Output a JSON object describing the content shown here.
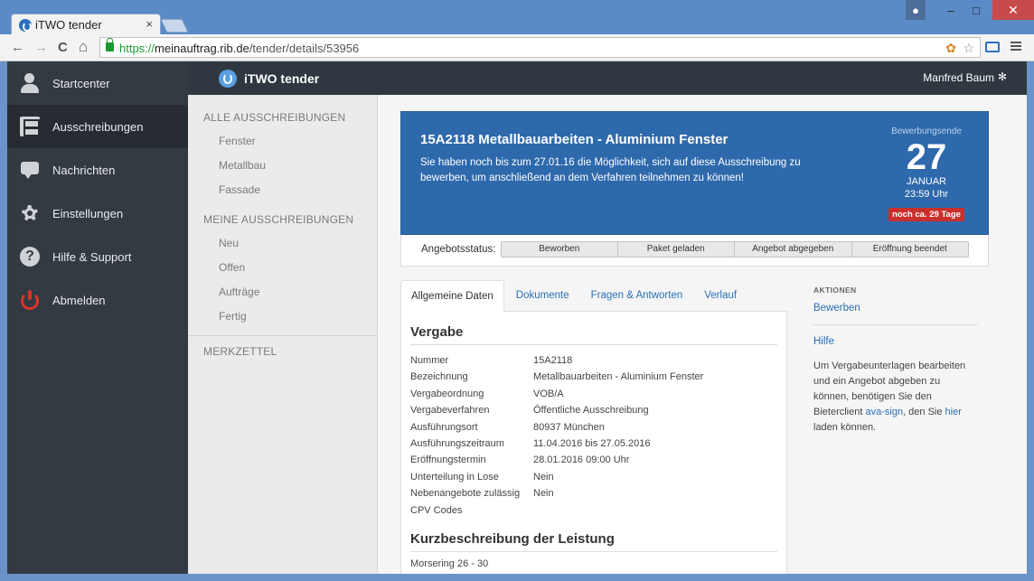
{
  "browser": {
    "tab_title": "iTWO tender",
    "tab_close": "×",
    "url_scheme": "https://",
    "url_host": "meinauftrag.rib.de",
    "url_path": "/tender/details/53956",
    "back_glyph": "←",
    "forward_glyph": "→",
    "reload_glyph": "C",
    "home_glyph": "⌂",
    "star_glyph": "☆",
    "win_min": "–",
    "win_max": "□",
    "win_close": "✕"
  },
  "app": {
    "brand": "iTWO tender",
    "user": "Manfred Baum",
    "user_gear": "✻"
  },
  "leftnav": {
    "items": [
      {
        "label": "Startcenter",
        "icon": "user-icon"
      },
      {
        "label": "Ausschreibungen",
        "icon": "cabinet-icon"
      },
      {
        "label": "Nachrichten",
        "icon": "chat-icon"
      },
      {
        "label": "Einstellungen",
        "icon": "gear-icon"
      },
      {
        "label": "Hilfe & Support",
        "icon": "help-icon"
      },
      {
        "label": "Abmelden",
        "icon": "power-icon"
      }
    ]
  },
  "subnav": {
    "all_header": "ALLE AUSSCHREIBUNGEN",
    "all_items": [
      "Fenster",
      "Metallbau",
      "Fassade"
    ],
    "mine_header": "MEINE AUSSCHREIBUNGEN",
    "mine_items": [
      "Neu",
      "Offen",
      "Aufträge",
      "Fertig"
    ],
    "watch_header": "MERKZETTEL"
  },
  "banner": {
    "title": "15A2118 Metallbauarbeiten - Aluminium Fenster",
    "text": "Sie haben noch bis zum 27.01.16 die Möglichkeit, sich auf diese Ausschreibung zu bewerben, um anschließend an dem Verfahren teilnehmen zu können!",
    "deadline_label": "Bewerbungsende",
    "deadline_day": "27",
    "deadline_month": "JANUAR",
    "deadline_time": "23:59 Uhr",
    "deadline_badge": "noch ca. 29 Tage"
  },
  "status": {
    "label": "Angebotsstatus:",
    "steps": [
      "Beworben",
      "Paket geladen",
      "Angebot abgegeben",
      "Eröffnung beendet"
    ]
  },
  "tabs": [
    "Allgemeine Daten",
    "Dokumente",
    "Fragen & Antworten",
    "Verlauf"
  ],
  "vergabe": {
    "title": "Vergabe",
    "rows": [
      {
        "k": "Nummer",
        "v": "15A2118"
      },
      {
        "k": "Bezeichnung",
        "v": "Metallbauarbeiten - Aluminium Fenster"
      },
      {
        "k": "Vergabeordnung",
        "v": "VOB/A"
      },
      {
        "k": "Vergabeverfahren",
        "v": "Öffentliche Ausschreibung"
      },
      {
        "k": "Ausführungsort",
        "v": "80937 München"
      },
      {
        "k": "Ausführungszeitraum",
        "v": "11.04.2016 bis 27.05.2016"
      },
      {
        "k": "Eröffnungstermin",
        "v": "28.01.2016 09:00 Uhr"
      },
      {
        "k": "Unterteilung in Lose",
        "v": "Nein"
      },
      {
        "k": "Nebenangebote zulässig",
        "v": "Nein"
      },
      {
        "k": "CPV Codes",
        "v": ""
      }
    ]
  },
  "kurz": {
    "title": "Kurzbeschreibung der Leistung",
    "text": "Morsering 26 - 30"
  },
  "aside": {
    "head": "AKTIONEN",
    "apply": "Bewerben",
    "help": "Hilfe",
    "text_1": "Um Vergabeunterlagen bearbeiten und ein Angebot abgeben zu können, benötigen Sie den Bieterclient ",
    "link_1": "ava-sign",
    "text_2": ", den Sie ",
    "link_2": "hier",
    "text_3": " laden können."
  }
}
